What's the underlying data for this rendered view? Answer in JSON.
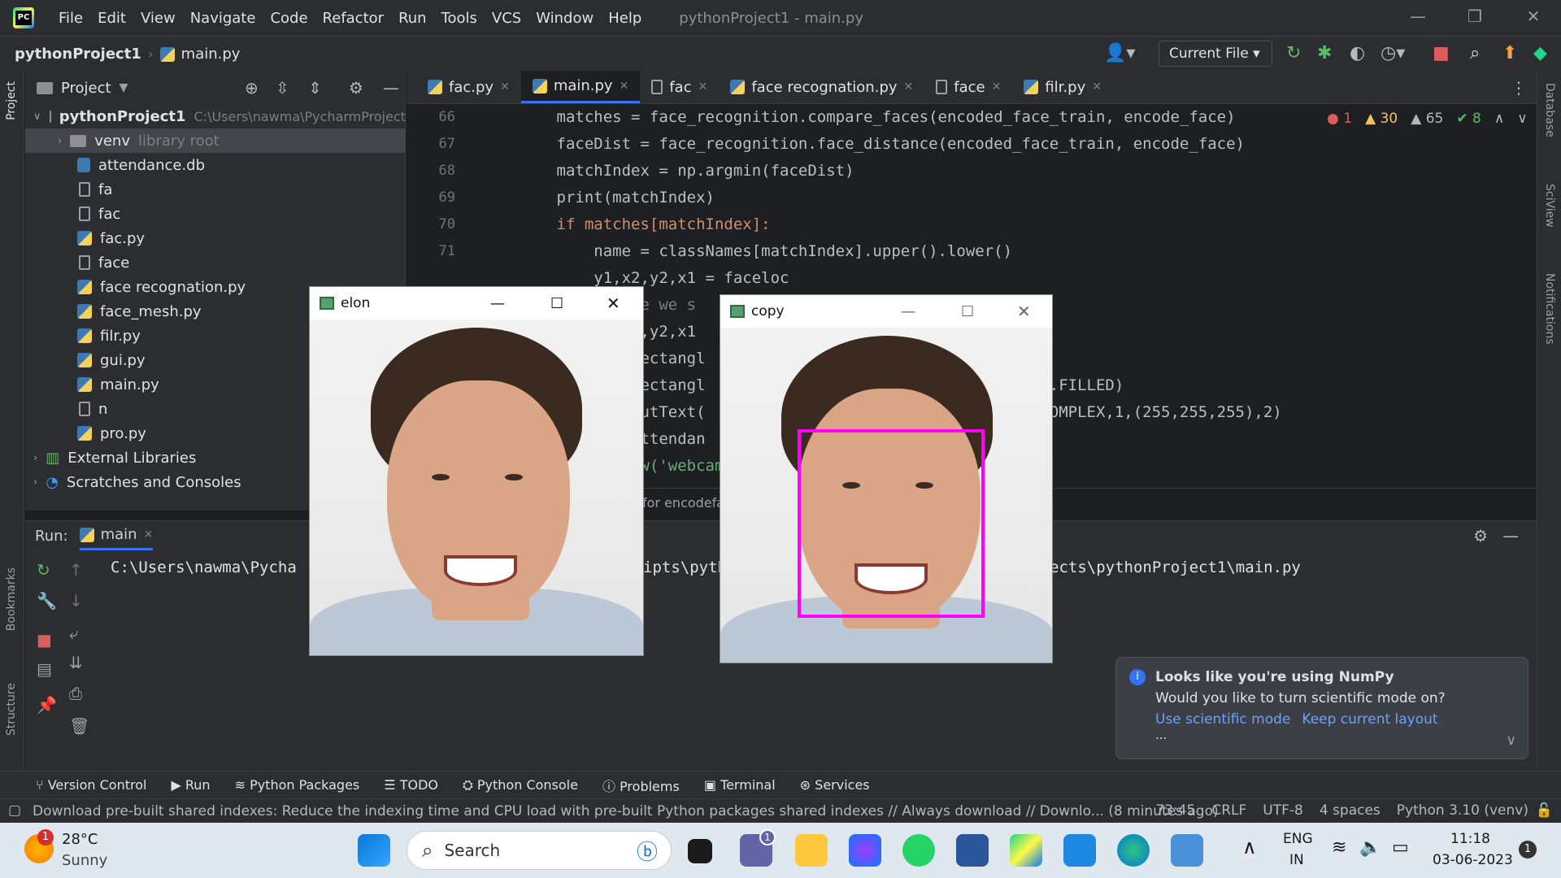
{
  "menu": [
    "File",
    "Edit",
    "View",
    "Navigate",
    "Code",
    "Refactor",
    "Run",
    "Tools",
    "VCS",
    "Window",
    "Help"
  ],
  "window_title": "pythonProject1 - main.py",
  "breadcrumb": {
    "project": "pythonProject1",
    "file": "main.py"
  },
  "run_config": "Current File",
  "left_strip": {
    "project": "Project",
    "bookmarks": "Bookmarks",
    "structure": "Structure"
  },
  "right_strip": {
    "database": "Database",
    "sciview": "SciView",
    "notifications": "Notifications"
  },
  "project_panel": {
    "title": "Project",
    "root": {
      "name": "pythonProject1",
      "path": "C:\\Users\\nawma\\PycharmProject"
    },
    "items": [
      {
        "name": "venv",
        "note": "library root",
        "type": "folder"
      },
      {
        "name": "attendance.db",
        "type": "db"
      },
      {
        "name": "fa",
        "type": "file"
      },
      {
        "name": "fac",
        "type": "file"
      },
      {
        "name": "fac.py",
        "type": "py"
      },
      {
        "name": "face",
        "type": "file"
      },
      {
        "name": "face recognation.py",
        "type": "py"
      },
      {
        "name": "face_mesh.py",
        "type": "py"
      },
      {
        "name": "filr.py",
        "type": "py"
      },
      {
        "name": "gui.py",
        "type": "py"
      },
      {
        "name": "main.py",
        "type": "py"
      },
      {
        "name": "n",
        "type": "file"
      },
      {
        "name": "pro.py",
        "type": "py"
      }
    ],
    "external": "External Libraries",
    "scratches": "Scratches and Consoles"
  },
  "tabs": [
    {
      "label": "fac.py",
      "type": "py"
    },
    {
      "label": "main.py",
      "type": "py",
      "active": true
    },
    {
      "label": "fac",
      "type": "file"
    },
    {
      "label": "face recognation.py",
      "type": "py"
    },
    {
      "label": "face",
      "type": "file"
    },
    {
      "label": "filr.py",
      "type": "py"
    }
  ],
  "problems": {
    "errors": "1",
    "warnings": "30",
    "weak": "65",
    "ok": "8"
  },
  "code_lines": [
    {
      "n": "66",
      "text": "        matches = face_recognition.compare_faces(encoded_face_train, encode_face)"
    },
    {
      "n": "67",
      "text": "        faceDist = face_recognition.face_distance(encoded_face_train, encode_face)"
    },
    {
      "n": "68",
      "text": "        matchIndex = np.argmin(faceDist)"
    },
    {
      "n": "69",
      "text": "        print(matchIndex)"
    },
    {
      "n": "70",
      "text": "        if matches[matchIndex]:"
    },
    {
      "n": "71",
      "text": "            name = classNames[matchIndex].upper().lower()"
    },
    {
      "n": "",
      "text": "            y1,x2,y2,x1 = faceloc"
    },
    {
      "n": "",
      "text": "            #since we s"
    },
    {
      "n": "",
      "text": "            y1,x2,y2,x1"
    },
    {
      "n": "",
      "text": "            cv2.rectangl"
    },
    {
      "n": "",
      "text": "            cv2.rectangl                              0), cv2.FILLED)"
    },
    {
      "n": "",
      "text": "            cv2.putText(                              RSHEY_COMPLEX,1,(255,255,255),2)"
    },
    {
      "n": "",
      "text": "            markAttendan"
    },
    {
      "n": "",
      "text": "        cv2.imshow('webcam',"
    }
  ],
  "editor_breadcrumb": "for encodeface,faceloc in zip...",
  "run": {
    "label": "Run:",
    "tab": "main",
    "console_left": "C:\\Users\\nawma\\Pycha",
    "console_mid": "ipts\\pyth",
    "console_right": "ects\\pythonProject1\\main.py"
  },
  "image_windows": [
    {
      "title": "elon"
    },
    {
      "title": "copy"
    }
  ],
  "notification": {
    "title": "Looks like you're using NumPy",
    "body": "Would you like to turn scientific mode on?",
    "action1": "Use scientific mode",
    "action2": "Keep current layout",
    "more": "..."
  },
  "bottom_tabs": [
    "Version Control",
    "Run",
    "Python Packages",
    "TODO",
    "Python Console",
    "Problems",
    "Terminal",
    "Services"
  ],
  "status": {
    "message": "Download pre-built shared indexes: Reduce the indexing time and CPU load with pre-built Python packages shared indexes // Always download // Downlo... (8 minutes ago)",
    "position": "73:45",
    "line_sep": "CRLF",
    "encoding": "UTF-8",
    "indent": "4 spaces",
    "interpreter": "Python 3.10 (venv)"
  },
  "taskbar": {
    "weather_temp": "28°C",
    "weather_desc": "Sunny",
    "weather_badge": "1",
    "search": "Search",
    "lang1": "ENG",
    "lang2": "IN",
    "time": "11:18",
    "date": "03-06-2023",
    "notif_count": "1",
    "teams_badge": "1"
  },
  "colors": {
    "accent": "#3574f0",
    "face_box": "#ff00ff"
  }
}
